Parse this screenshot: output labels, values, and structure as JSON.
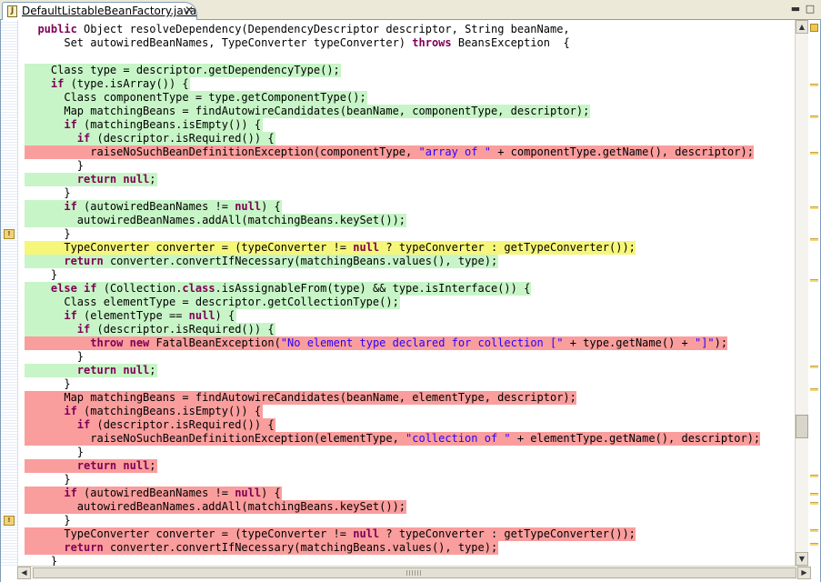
{
  "tab": {
    "title": "DefaultListableBeanFactory.java",
    "icon": "J",
    "close": "✕"
  },
  "window": {
    "minimize": "▬",
    "maximize": "□"
  },
  "scroll": {
    "up": "▲",
    "down": "▼",
    "left": "◀",
    "right": "▶"
  },
  "ruler_marks": [
    {
      "line": 15,
      "glyph": "!"
    },
    {
      "line": 36,
      "glyph": "!"
    }
  ],
  "lines": [
    {
      "hl": "",
      "parts": [
        [
          "  ",
          ""
        ],
        [
          "public",
          "kw"
        ],
        [
          " Object resolveDependency(DependencyDescriptor descriptor, String beanName,",
          ""
        ]
      ]
    },
    {
      "hl": "",
      "parts": [
        [
          "      Set autowiredBeanNames, TypeConverter typeConverter) ",
          ""
        ],
        [
          "throws",
          "kw"
        ],
        [
          " BeansException  {",
          ""
        ]
      ]
    },
    {
      "hl": "",
      "parts": [
        [
          "",
          ""
        ]
      ]
    },
    {
      "hl": "green",
      "parts": [
        [
          "    Class type = descriptor.getDependencyType();",
          ""
        ]
      ]
    },
    {
      "hl": "green",
      "parts": [
        [
          "    ",
          ""
        ],
        [
          "if",
          "kw"
        ],
        [
          " (type.isArray()) {",
          ""
        ]
      ]
    },
    {
      "hl": "green",
      "parts": [
        [
          "      Class componentType = type.getComponentType();",
          ""
        ]
      ]
    },
    {
      "hl": "green",
      "parts": [
        [
          "      Map matchingBeans = findAutowireCandidates(beanName, componentType, descriptor);",
          ""
        ]
      ]
    },
    {
      "hl": "green",
      "parts": [
        [
          "      ",
          ""
        ],
        [
          "if",
          "kw"
        ],
        [
          " (matchingBeans.isEmpty()) {",
          ""
        ]
      ]
    },
    {
      "hl": "green",
      "parts": [
        [
          "        ",
          ""
        ],
        [
          "if",
          "kw"
        ],
        [
          " (descriptor.isRequired()) {",
          ""
        ]
      ]
    },
    {
      "hl": "red",
      "parts": [
        [
          "          raiseNoSuchBeanDefinitionException(componentType, ",
          ""
        ],
        [
          "\"array of \"",
          "str"
        ],
        [
          " + componentType.getName(), descriptor);",
          ""
        ]
      ]
    },
    {
      "hl": "",
      "parts": [
        [
          "        }",
          ""
        ]
      ]
    },
    {
      "hl": "green",
      "parts": [
        [
          "        ",
          ""
        ],
        [
          "return",
          "kw"
        ],
        [
          " ",
          ""
        ],
        [
          "null",
          "kw"
        ],
        [
          ";",
          ""
        ]
      ]
    },
    {
      "hl": "",
      "parts": [
        [
          "      }",
          ""
        ]
      ]
    },
    {
      "hl": "green",
      "parts": [
        [
          "      ",
          ""
        ],
        [
          "if",
          "kw"
        ],
        [
          " (autowiredBeanNames != ",
          ""
        ],
        [
          "null",
          "kw"
        ],
        [
          ") {",
          ""
        ]
      ]
    },
    {
      "hl": "green",
      "parts": [
        [
          "        autowiredBeanNames.addAll(matchingBeans.keySet());",
          ""
        ]
      ]
    },
    {
      "hl": "",
      "parts": [
        [
          "      }",
          ""
        ]
      ]
    },
    {
      "hl": "yellow",
      "parts": [
        [
          "      TypeConverter converter = (typeConverter != ",
          ""
        ],
        [
          "null",
          "kw"
        ],
        [
          " ? typeConverter : getTypeConverter());",
          ""
        ]
      ]
    },
    {
      "hl": "green",
      "parts": [
        [
          "      ",
          ""
        ],
        [
          "return",
          "kw"
        ],
        [
          " converter.convertIfNecessary(matchingBeans.values(), type);",
          ""
        ]
      ]
    },
    {
      "hl": "",
      "parts": [
        [
          "    }",
          ""
        ]
      ]
    },
    {
      "hl": "green",
      "parts": [
        [
          "    ",
          ""
        ],
        [
          "else",
          "kw"
        ],
        [
          " ",
          ""
        ],
        [
          "if",
          "kw"
        ],
        [
          " (Collection.",
          ""
        ],
        [
          "class",
          "kw"
        ],
        [
          ".isAssignableFrom(type) && type.isInterface()) {",
          ""
        ]
      ]
    },
    {
      "hl": "green",
      "parts": [
        [
          "      Class elementType = descriptor.getCollectionType();",
          ""
        ]
      ]
    },
    {
      "hl": "green",
      "parts": [
        [
          "      ",
          ""
        ],
        [
          "if",
          "kw"
        ],
        [
          " (elementType == ",
          ""
        ],
        [
          "null",
          "kw"
        ],
        [
          ") {",
          ""
        ]
      ]
    },
    {
      "hl": "green",
      "parts": [
        [
          "        ",
          ""
        ],
        [
          "if",
          "kw"
        ],
        [
          " (descriptor.isRequired()) {",
          ""
        ]
      ]
    },
    {
      "hl": "red",
      "parts": [
        [
          "          ",
          ""
        ],
        [
          "throw",
          "kw"
        ],
        [
          " ",
          ""
        ],
        [
          "new",
          "kw"
        ],
        [
          " FatalBeanException(",
          ""
        ],
        [
          "\"No element type declared for collection [\"",
          "str"
        ],
        [
          " + type.getName() + ",
          ""
        ],
        [
          "\"]\"",
          "str"
        ],
        [
          ");",
          ""
        ]
      ]
    },
    {
      "hl": "",
      "parts": [
        [
          "        }",
          ""
        ]
      ]
    },
    {
      "hl": "green",
      "parts": [
        [
          "        ",
          ""
        ],
        [
          "return",
          "kw"
        ],
        [
          " ",
          ""
        ],
        [
          "null",
          "kw"
        ],
        [
          ";",
          ""
        ]
      ]
    },
    {
      "hl": "",
      "parts": [
        [
          "      }",
          ""
        ]
      ]
    },
    {
      "hl": "red",
      "parts": [
        [
          "      Map matchingBeans = findAutowireCandidates(beanName, elementType, descriptor);",
          ""
        ]
      ]
    },
    {
      "hl": "red",
      "parts": [
        [
          "      ",
          ""
        ],
        [
          "if",
          "kw"
        ],
        [
          " (matchingBeans.isEmpty()) {",
          ""
        ]
      ]
    },
    {
      "hl": "red",
      "parts": [
        [
          "        ",
          ""
        ],
        [
          "if",
          "kw"
        ],
        [
          " (descriptor.isRequired()) {",
          ""
        ]
      ]
    },
    {
      "hl": "red",
      "parts": [
        [
          "          raiseNoSuchBeanDefinitionException(elementType, ",
          ""
        ],
        [
          "\"collection of \"",
          "str"
        ],
        [
          " + elementType.getName(), descriptor);",
          ""
        ]
      ]
    },
    {
      "hl": "",
      "parts": [
        [
          "        }",
          ""
        ]
      ]
    },
    {
      "hl": "red",
      "parts": [
        [
          "        ",
          ""
        ],
        [
          "return",
          "kw"
        ],
        [
          " ",
          ""
        ],
        [
          "null",
          "kw"
        ],
        [
          ";",
          ""
        ]
      ]
    },
    {
      "hl": "",
      "parts": [
        [
          "      }",
          ""
        ]
      ]
    },
    {
      "hl": "red",
      "parts": [
        [
          "      ",
          ""
        ],
        [
          "if",
          "kw"
        ],
        [
          " (autowiredBeanNames != ",
          ""
        ],
        [
          "null",
          "kw"
        ],
        [
          ") {",
          ""
        ]
      ]
    },
    {
      "hl": "red",
      "parts": [
        [
          "        autowiredBeanNames.addAll(matchingBeans.keySet());",
          ""
        ]
      ]
    },
    {
      "hl": "",
      "parts": [
        [
          "      }",
          ""
        ]
      ]
    },
    {
      "hl": "red",
      "parts": [
        [
          "      TypeConverter converter = (typeConverter != ",
          ""
        ],
        [
          "null",
          "kw"
        ],
        [
          " ? typeConverter : getTypeConverter());",
          ""
        ]
      ]
    },
    {
      "hl": "red",
      "parts": [
        [
          "      ",
          ""
        ],
        [
          "return",
          "kw"
        ],
        [
          " converter.convertIfNecessary(matchingBeans.values(), type);",
          ""
        ]
      ]
    },
    {
      "hl": "",
      "parts": [
        [
          "    }",
          ""
        ]
      ]
    }
  ]
}
